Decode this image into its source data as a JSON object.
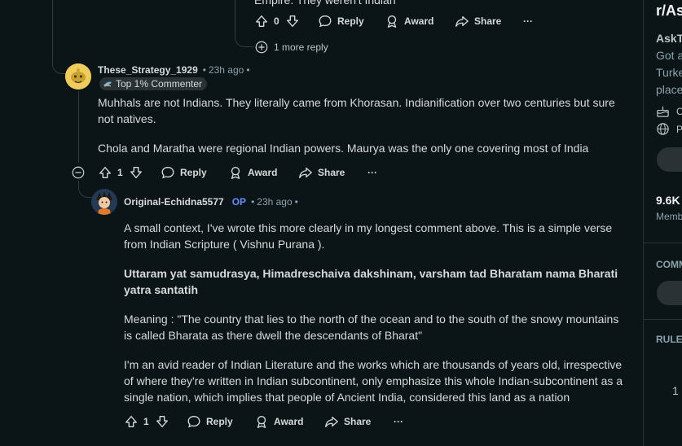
{
  "top_comment": {
    "cut_text": "Empire. They weren't Indian",
    "votes": "0",
    "reply_label": "Reply",
    "award_label": "Award",
    "share_label": "Share",
    "more_label": "···",
    "more_replies": "1 more reply"
  },
  "comment_1": {
    "username": "These_Strategy_1929",
    "time": "23h ago",
    "dot": "•",
    "flair": "Top 1% Commenter",
    "paragraphs": [
      "Muhhals are not Indians. They literally came from Khorasan. Indianification over two centuries but sure not natives.",
      "Chola and Maratha were regional Indian powers. Maurya was the only one covering most of India"
    ],
    "votes": "1",
    "reply_label": "Reply",
    "award_label": "Award",
    "share_label": "Share",
    "more_label": "···"
  },
  "comment_2": {
    "username": "Original-Echidna5577",
    "op_badge": "OP",
    "time": "23h ago",
    "dot": "•",
    "paragraphs": [
      "A small context, I've wrote this more clearly in my longest comment above. This is a simple verse from Indian Scripture ( Vishnu Purana ).",
      "Uttaram yat samudrasya, Himadreschaiva dakshinam, varsham tad Bharatam nama Bharati yatra santatih",
      "Meaning : \"The country that lies to the north of the ocean and to the south of the snowy mountains is called Bharata as there dwell the descendants of Bharat\"",
      "I'm an avid reader of Indian Literature and the works which are thousands of years old, irrespective of where they're written in Indian subcontinent, only emphasize this whole Indian-subcontinent as a single nation, which implies that people of Ancient India, considered this land as a nation"
    ],
    "votes": "1",
    "reply_label": "Reply",
    "award_label": "Award",
    "share_label": "Share",
    "more_label": "···"
  },
  "sidebar": {
    "subreddit": "r/As",
    "name": "AskT",
    "desc_lines": [
      "Got a",
      "Turke",
      "place"
    ],
    "row1": "C",
    "row2": "P",
    "members_count": "9.6K",
    "members_label": "Memb",
    "section1": "COMM",
    "section2": "RULE",
    "rule_num": "1"
  },
  "colors": {
    "background": "#0b1416",
    "op_blue": "#648efc",
    "meta": "#8ba2ad"
  }
}
